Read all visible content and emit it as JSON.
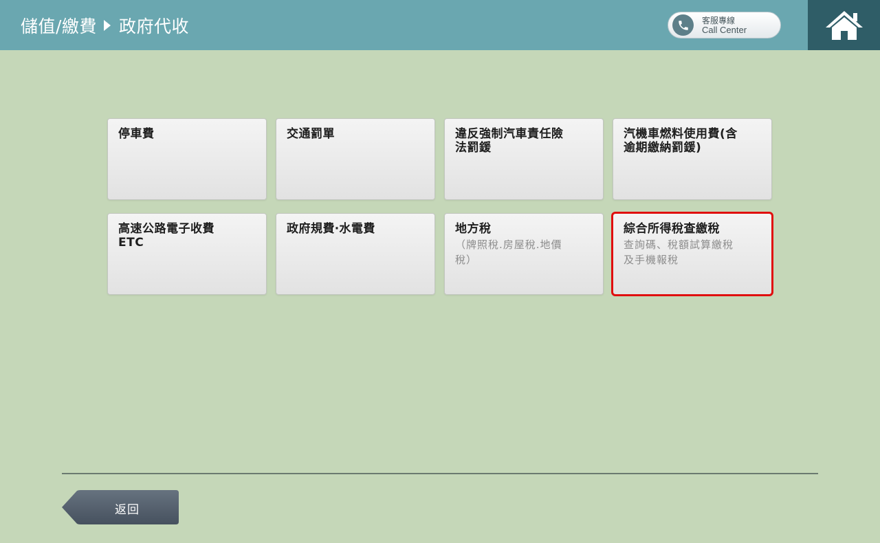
{
  "header": {
    "breadcrumb_parent": "儲值/繳費",
    "breadcrumb_current": "政府代收",
    "call_center_zh": "客服專線",
    "call_center_en": "Call Center"
  },
  "tiles": [
    {
      "title": "停車費",
      "subtitle": ""
    },
    {
      "title": "交通罰單",
      "subtitle": ""
    },
    {
      "title": "違反強制汽車責任險\n法罰鍰",
      "subtitle": ""
    },
    {
      "title": "汽機車燃料使用費(含\n逾期繳納罰鍰)",
      "subtitle": ""
    },
    {
      "title": "高速公路電子收費\nETC",
      "subtitle": ""
    },
    {
      "title": "政府規費‧水電費",
      "subtitle": ""
    },
    {
      "title": "地方稅",
      "subtitle": "（牌照稅.房屋稅.地價\n稅）"
    },
    {
      "title": "綜合所得稅查繳稅",
      "subtitle": "查詢碼、稅額試算繳稅\n及手機報稅",
      "highlighted": true
    }
  ],
  "footer": {
    "back_label": "返回"
  },
  "colors": {
    "background": "#c5d7b8",
    "header": "#6aa7b0",
    "home_button": "#2f5d67",
    "highlight_border": "#e00e0e",
    "back_button": "#4f5b6a"
  }
}
